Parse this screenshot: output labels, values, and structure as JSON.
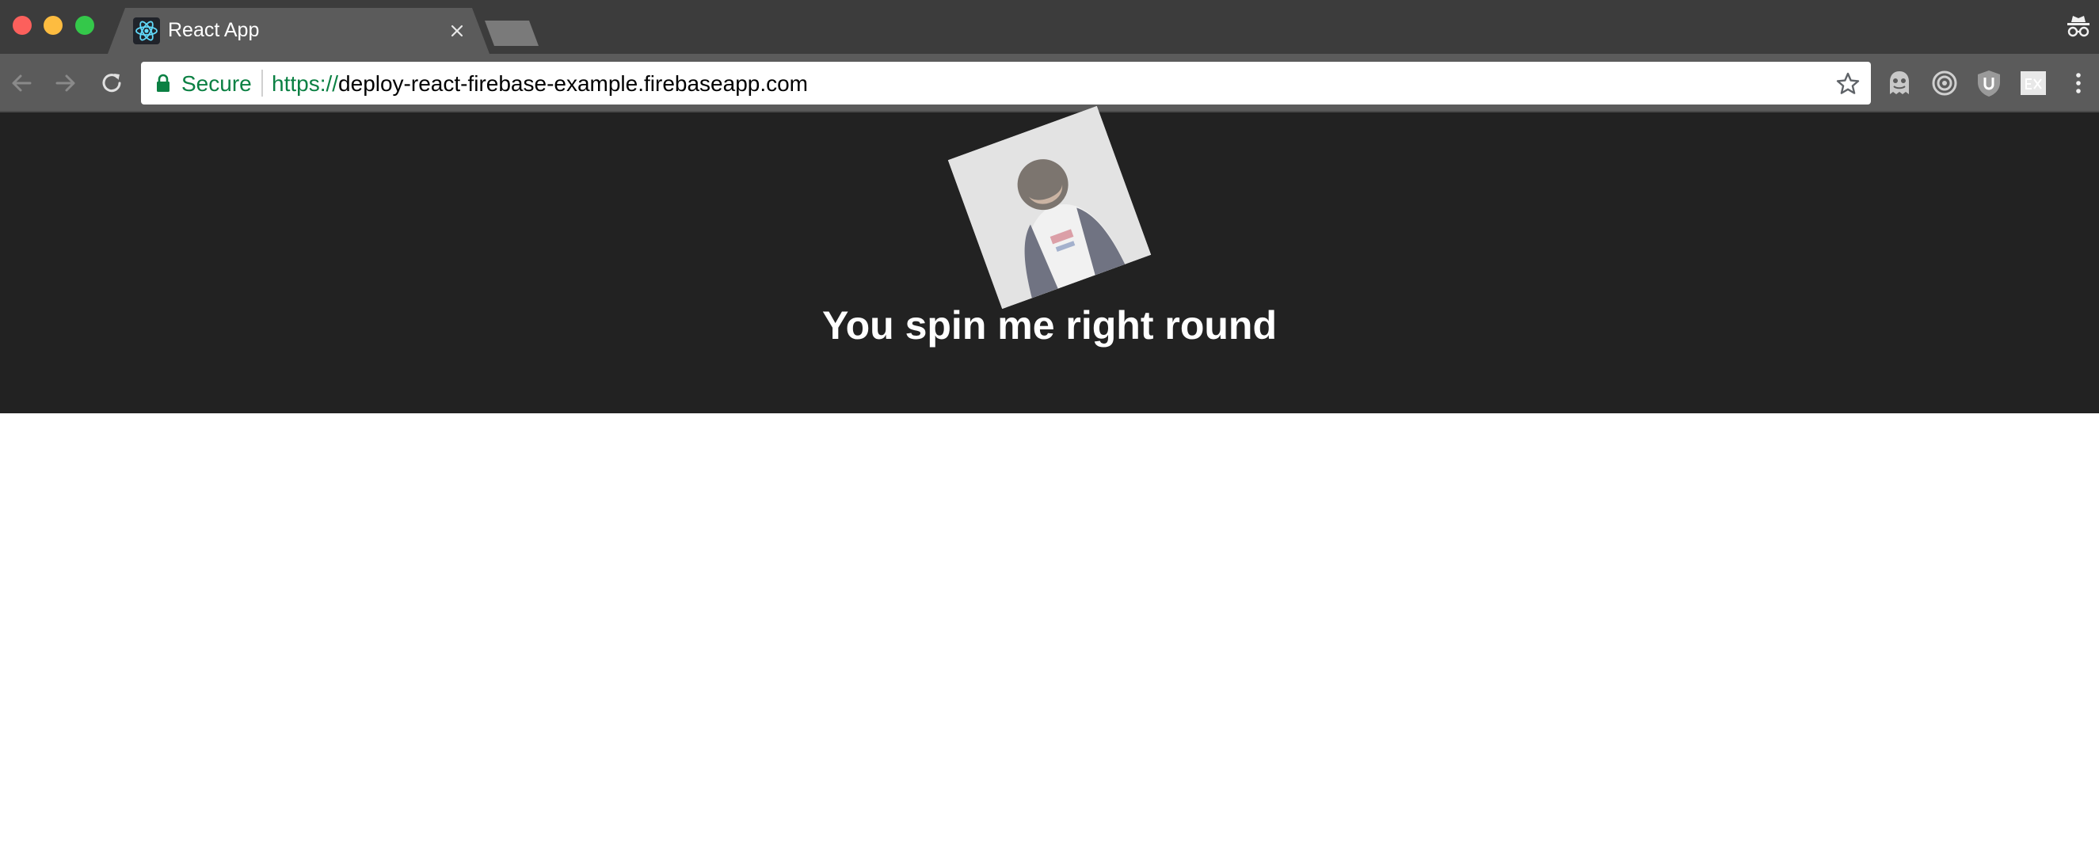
{
  "browser": {
    "tab": {
      "title": "React App",
      "favicon": "react-logo-icon"
    },
    "address_bar": {
      "security_label": "Secure",
      "url_scheme": "https://",
      "url_host": "deploy-react-firebase-example.firebaseapp.com"
    },
    "extensions": [
      "ghostery-icon",
      "target-icon",
      "ublock-icon",
      "ex-icon"
    ]
  },
  "app": {
    "title": "You spin me right round"
  },
  "colors": {
    "titlebar": "#3c3c3c",
    "toolbar": "#5b5b5b",
    "secure_green": "#0b8043",
    "app_header": "#222222",
    "react_blue": "#61dafb"
  }
}
